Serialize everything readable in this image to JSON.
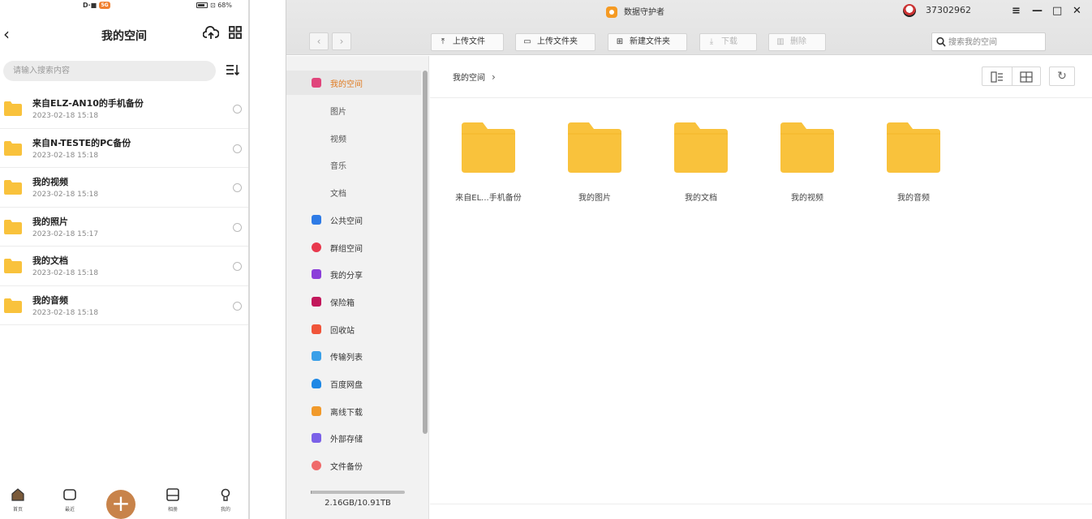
{
  "mobile": {
    "status": {
      "left": "D·■",
      "badge": "5G",
      "right": "⊡ 68%"
    },
    "title": "我的空间",
    "search_placeholder": "请输入搜索内容",
    "items": [
      {
        "name": "来自ELZ-AN10的手机备份",
        "meta": "2023-02-18 15:18"
      },
      {
        "name": "来自N-TESTE的PC备份",
        "meta": "2023-02-18 15:18"
      },
      {
        "name": "我的视频",
        "meta": "2023-02-18 15:18"
      },
      {
        "name": "我的照片",
        "meta": "2023-02-18 15:17"
      },
      {
        "name": "我的文档",
        "meta": "2023-02-18 15:18"
      },
      {
        "name": "我的音频",
        "meta": "2023-02-18 15:18"
      }
    ],
    "tabs": [
      {
        "label": "首页"
      },
      {
        "label": "最近"
      },
      {
        "label": "相册"
      },
      {
        "label": "我的"
      }
    ],
    "plus": "+"
  },
  "window": {
    "app_title": "数据守护者",
    "user_id": "37302962",
    "controls": {
      "menu": "≡",
      "min": "—",
      "max": "□",
      "close": "✕"
    },
    "nav": {
      "back": "‹",
      "forward": "›"
    },
    "toolbar": {
      "upload_file": "上传文件",
      "upload_folder": "上传文件夹",
      "new_folder": "新建文件夹",
      "download": "下载",
      "delete": "删除"
    },
    "search_placeholder": "搜索我的空间",
    "sidebar": {
      "items": [
        {
          "label": "我的空间",
          "color": "#e0457b",
          "active": true,
          "sub": false
        },
        {
          "label": "图片",
          "color": "",
          "active": false,
          "sub": true
        },
        {
          "label": "视频",
          "color": "",
          "active": false,
          "sub": true
        },
        {
          "label": "音乐",
          "color": "",
          "active": false,
          "sub": true
        },
        {
          "label": "文档",
          "color": "",
          "active": false,
          "sub": true
        },
        {
          "label": "公共空间",
          "color": "#2e7be6",
          "active": false,
          "sub": false
        },
        {
          "label": "群组空间",
          "color": "#e8394d",
          "active": false,
          "sub": false
        },
        {
          "label": "我的分享",
          "color": "#8b3fd9",
          "active": false,
          "sub": false
        },
        {
          "label": "保险箱",
          "color": "#c2185b",
          "active": false,
          "sub": false
        },
        {
          "label": "回收站",
          "color": "#f0553a",
          "active": false,
          "sub": false
        },
        {
          "label": "传输列表",
          "color": "#3aa0e8",
          "active": false,
          "sub": false
        },
        {
          "label": "百度网盘",
          "color": "#1e88e5",
          "active": false,
          "sub": false
        },
        {
          "label": "离线下载",
          "color": "#f19a2b",
          "active": false,
          "sub": false
        },
        {
          "label": "外部存储",
          "color": "#7b61e8",
          "active": false,
          "sub": false
        },
        {
          "label": "文件备份",
          "color": "#ef6a6a",
          "active": false,
          "sub": false
        }
      ],
      "storage_text": "2.16GB/10.91TB",
      "storage_fraction": 0.0002
    },
    "breadcrumb": "我的空间",
    "folders": [
      {
        "name": "来自EL...手机备份"
      },
      {
        "name": "我的图片"
      },
      {
        "name": "我的文档"
      },
      {
        "name": "我的视频"
      },
      {
        "name": "我的音频"
      }
    ],
    "folder_color": "#f9c23c"
  }
}
